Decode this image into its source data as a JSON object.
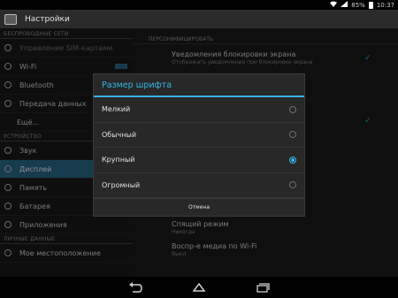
{
  "status_bar": {
    "battery": "85%",
    "time": "10:37"
  },
  "action_bar": {
    "title": "Настройки"
  },
  "sidebar": {
    "sections": [
      {
        "header": "БЕСПРОВОДНЫЕ СЕТИ",
        "items": [
          {
            "label": "Управление SIM-картами",
            "icon": "sim-icon",
            "state": "disabled"
          },
          {
            "label": "Wi-Fi",
            "icon": "wifi-icon"
          },
          {
            "label": "Bluetooth",
            "icon": "bluetooth-icon"
          },
          {
            "label": "Передача данных",
            "icon": "data-usage-icon"
          },
          {
            "label": "Ещё...",
            "icon": ""
          }
        ]
      },
      {
        "header": "УСТРОЙСТВО",
        "items": [
          {
            "label": "Звук",
            "icon": "sound-icon"
          },
          {
            "label": "Дисплей",
            "icon": "display-icon",
            "state": "selected"
          },
          {
            "label": "Память",
            "icon": "storage-icon"
          },
          {
            "label": "Батарея",
            "icon": "battery-icon"
          },
          {
            "label": "Приложения",
            "icon": "apps-icon"
          }
        ]
      },
      {
        "header": "ЛИЧНЫЕ ДАННЫЕ",
        "items": [
          {
            "label": "Мое местоположение",
            "icon": "location-icon"
          }
        ]
      }
    ]
  },
  "main": {
    "header": "ПЕРСОНИФИЦИРОВАТЬ",
    "settings": [
      {
        "title": "Уведомления блокировки экрана",
        "subtitle": "Отображать уведомления при блокировке экрана",
        "checked": true
      },
      {
        "title": "Спящий режим",
        "subtitle": "Никогда"
      },
      {
        "title": "Воспр-е медиа по Wi-Fi",
        "subtitle": "Выкл"
      }
    ]
  },
  "dialog": {
    "title": "Размер шрифта",
    "options": [
      {
        "label": "Мелкий",
        "selected": false
      },
      {
        "label": "Обычный",
        "selected": false
      },
      {
        "label": "Крупный",
        "selected": true
      },
      {
        "label": "Огромный",
        "selected": false
      }
    ],
    "cancel_label": "Отмена"
  },
  "colors": {
    "accent": "#33b5e5",
    "selected_bg": "#2a6e8e"
  }
}
